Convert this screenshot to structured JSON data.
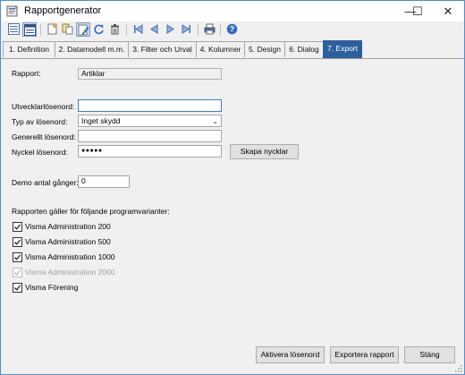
{
  "window": {
    "title": "Rapportgenerator",
    "controls": {
      "minimize": "—",
      "maximize": "☐",
      "close": "✕"
    }
  },
  "toolbar": {
    "buttons": [
      "list-view-icon",
      "details-view-icon",
      "new-icon",
      "copy-icon",
      "edit-icon",
      "refresh-icon",
      "delete-icon",
      "first-record-icon",
      "previous-record-icon",
      "next-record-icon",
      "last-record-icon",
      "print-icon",
      "help-icon"
    ]
  },
  "tabs": [
    {
      "label": "1. Definition",
      "active": false
    },
    {
      "label": "2. Datamodell m.m.",
      "active": false
    },
    {
      "label": "3. Filter och Urval",
      "active": false
    },
    {
      "label": "4. Kolumner",
      "active": false
    },
    {
      "label": "5. Design",
      "active": false
    },
    {
      "label": "6. Dialog",
      "active": false
    },
    {
      "label": "7. Export",
      "active": true
    }
  ],
  "form": {
    "rapport_label": "Rapport:",
    "rapport_value": "Artiklar",
    "developer_pw_label": "Utvecklarlösenord:",
    "developer_pw_value": "",
    "pw_type_label": "Typ av lösenord:",
    "pw_type_value": "Inget skydd",
    "general_pw_label": "Generellt lösenord:",
    "general_pw_value": "",
    "key_pw_label": "Nyckel lösenord:",
    "key_pw_value": "●●●●●",
    "create_keys_button": "Skapa nycklar",
    "demo_label": "Demo antal gånger:",
    "demo_value": "0",
    "variants_heading": "Rapporten gäller för följande programvarianter:",
    "variants": [
      {
        "label": "Visma Administration 200",
        "checked": true,
        "disabled": false
      },
      {
        "label": "Visma Administration 500",
        "checked": true,
        "disabled": false
      },
      {
        "label": "Visma Administration 1000",
        "checked": true,
        "disabled": false
      },
      {
        "label": "Visma Administration 2000",
        "checked": true,
        "disabled": true
      },
      {
        "label": "Visma Förening",
        "checked": true,
        "disabled": false
      }
    ]
  },
  "footer": {
    "activate_button": "Aktivera lösenord",
    "export_button": "Exportera rapport",
    "close_button": "Stäng"
  },
  "colors": {
    "active_tab": "#2c5f9e",
    "window_border": "#4a90d6",
    "focus_border": "#3c7fd6"
  }
}
